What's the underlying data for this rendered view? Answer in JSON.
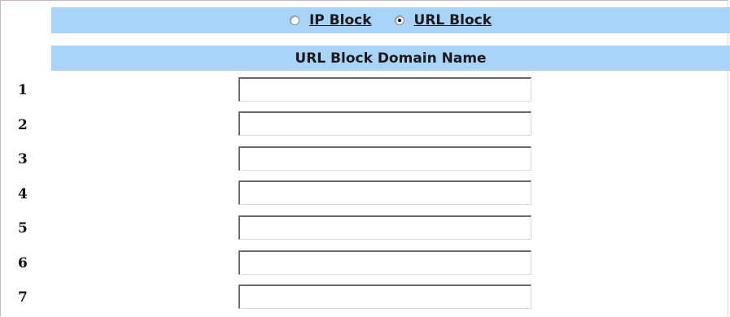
{
  "block_type": {
    "options": [
      {
        "label": "IP Block",
        "checked": false
      },
      {
        "label": "URL Block",
        "checked": true
      }
    ]
  },
  "table": {
    "header": "URL Block Domain Name",
    "rows": [
      {
        "num": "1",
        "value": ""
      },
      {
        "num": "2",
        "value": ""
      },
      {
        "num": "3",
        "value": ""
      },
      {
        "num": "4",
        "value": ""
      },
      {
        "num": "5",
        "value": ""
      },
      {
        "num": "6",
        "value": ""
      },
      {
        "num": "7",
        "value": ""
      }
    ]
  },
  "colors": {
    "header_bg": "#a8d4fa",
    "frame_border": "#c9b9b9"
  }
}
